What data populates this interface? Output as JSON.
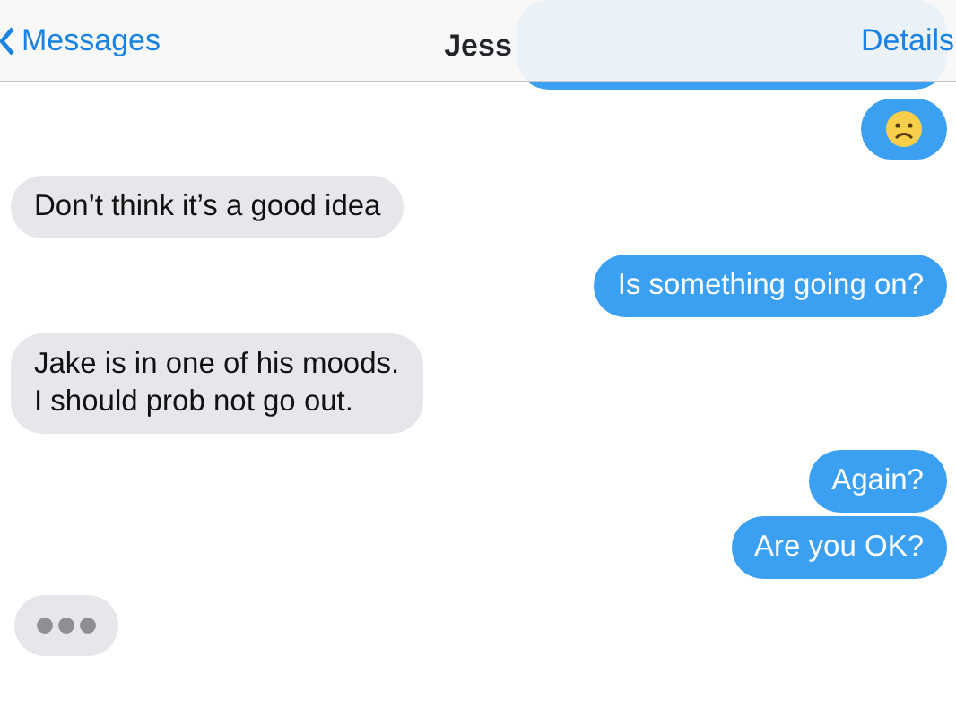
{
  "nav_bar": {
    "back_label": "Messages",
    "title": "Jess",
    "action": "Details"
  },
  "messages": [
    {
      "kind": "obscured"
    },
    {
      "kind": "emoji"
    },
    {
      "kind": "received",
      "text": "Don’t think it’s a good idea"
    },
    {
      "kind": "sent",
      "text": "Is something going on?"
    },
    {
      "kind": "received",
      "text": "Jake is in one of his moods.\nI should prob not go out."
    },
    {
      "kind": "sent",
      "text": "Again?"
    },
    {
      "kind": "sent",
      "text": "Are you OK?"
    },
    {
      "kind": "typing"
    }
  ]
}
